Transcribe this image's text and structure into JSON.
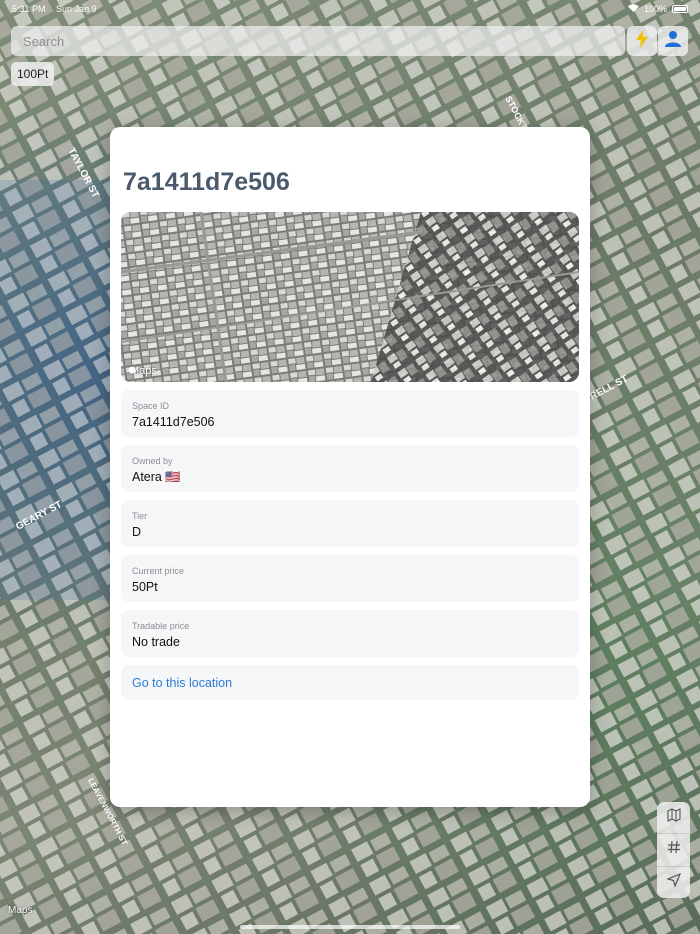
{
  "status_bar": {
    "time": "5:31 PM",
    "date": "Sun Jan 9",
    "battery": "100%"
  },
  "search": {
    "placeholder": "Search"
  },
  "points_badge": "100Pt",
  "modal": {
    "title": "7a1411d7e506",
    "preview_label": "Maps",
    "fields": [
      {
        "label": "Space ID",
        "value": "7a1411d7e506"
      },
      {
        "label": "Owned by",
        "value": "Atera 🇺🇸"
      },
      {
        "label": "Tier",
        "value": "D"
      },
      {
        "label": "Current price",
        "value": "50Pt"
      },
      {
        "label": "Tradable price",
        "value": "No trade"
      }
    ],
    "goto_label": "Go to this location"
  },
  "map": {
    "watermark": "Maps",
    "street_labels": [
      "TAYLOR ST",
      "GEARY ST",
      "STOCKTON",
      "LEAVENWORTH ST",
      "RELL ST"
    ]
  },
  "icons": {
    "bolt": "lightning-bolt-icon",
    "user": "person-icon",
    "map_mode": "map-icon",
    "grid": "hashtag-icon",
    "locate": "location-arrow-icon"
  },
  "colors": {
    "title": "#4a5a6a",
    "link": "#2a7ed6",
    "bolt": "#f2c200",
    "user": "#1f6fd8"
  }
}
